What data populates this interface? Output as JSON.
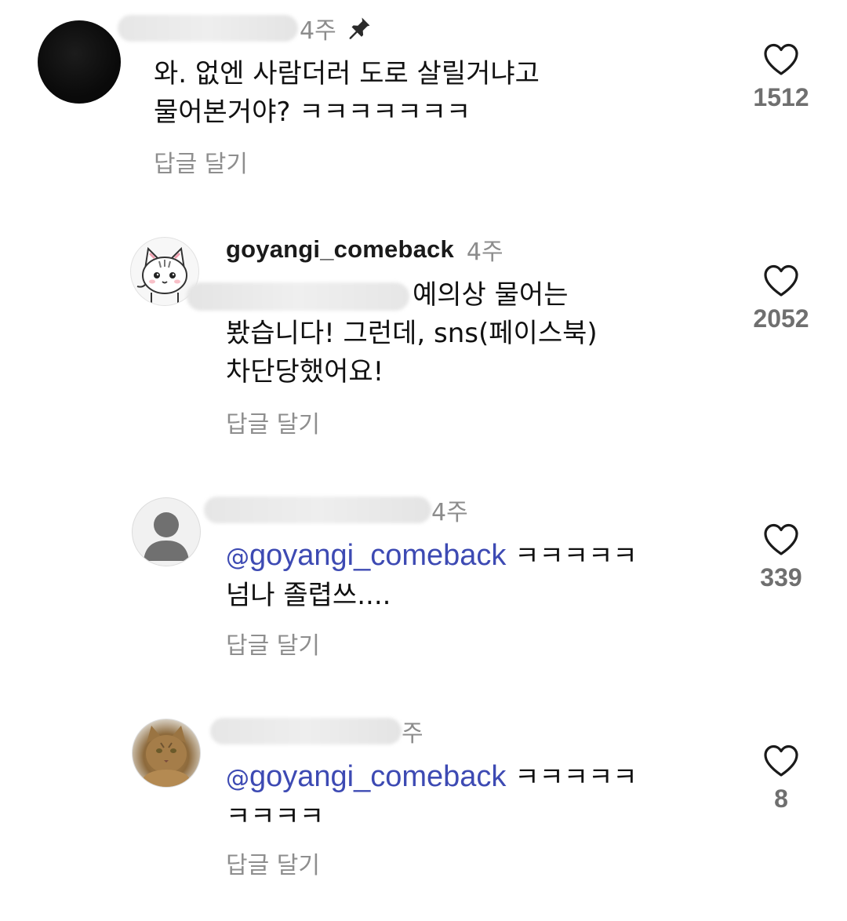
{
  "comments": [
    {
      "username": "",
      "time": "4주",
      "pinned": true,
      "lines": [
        "와. 없엔 사람더러 도로 살릴거냐고",
        "물어본거야? ㅋㅋㅋㅋㅋㅋㅋ"
      ],
      "reply_label": "답글 달기",
      "likes": "1512"
    },
    {
      "username": "goyangi_comeback",
      "time": "4주",
      "lines": [
        "예의상 물어는",
        "봤습니다! 그런데, sns(페이스북)",
        "차단당했어요!"
      ],
      "reply_label": "답글 달기",
      "likes": "2052"
    },
    {
      "username": "",
      "time": "4주",
      "mention": "goyangi_comeback",
      "lines": [
        " ㅋㅋㅋㅋㅋ",
        "넘나 졸렵쓰...."
      ],
      "reply_label": "답글 달기",
      "likes": "339"
    },
    {
      "username": "",
      "time": "주",
      "mention": "goyangi_comeback",
      "lines": [
        " ㅋㅋㅋㅋㅋ",
        "ㅋㅋㅋㅋ"
      ],
      "reply_label": "답글 달기",
      "likes": "8"
    }
  ],
  "icons": {
    "like": "heart-icon",
    "pin": "pin-icon",
    "mention": "threads-icon"
  },
  "colors": {
    "mention": "#3d4ab3",
    "secondary_text": "#8e8e8e"
  }
}
